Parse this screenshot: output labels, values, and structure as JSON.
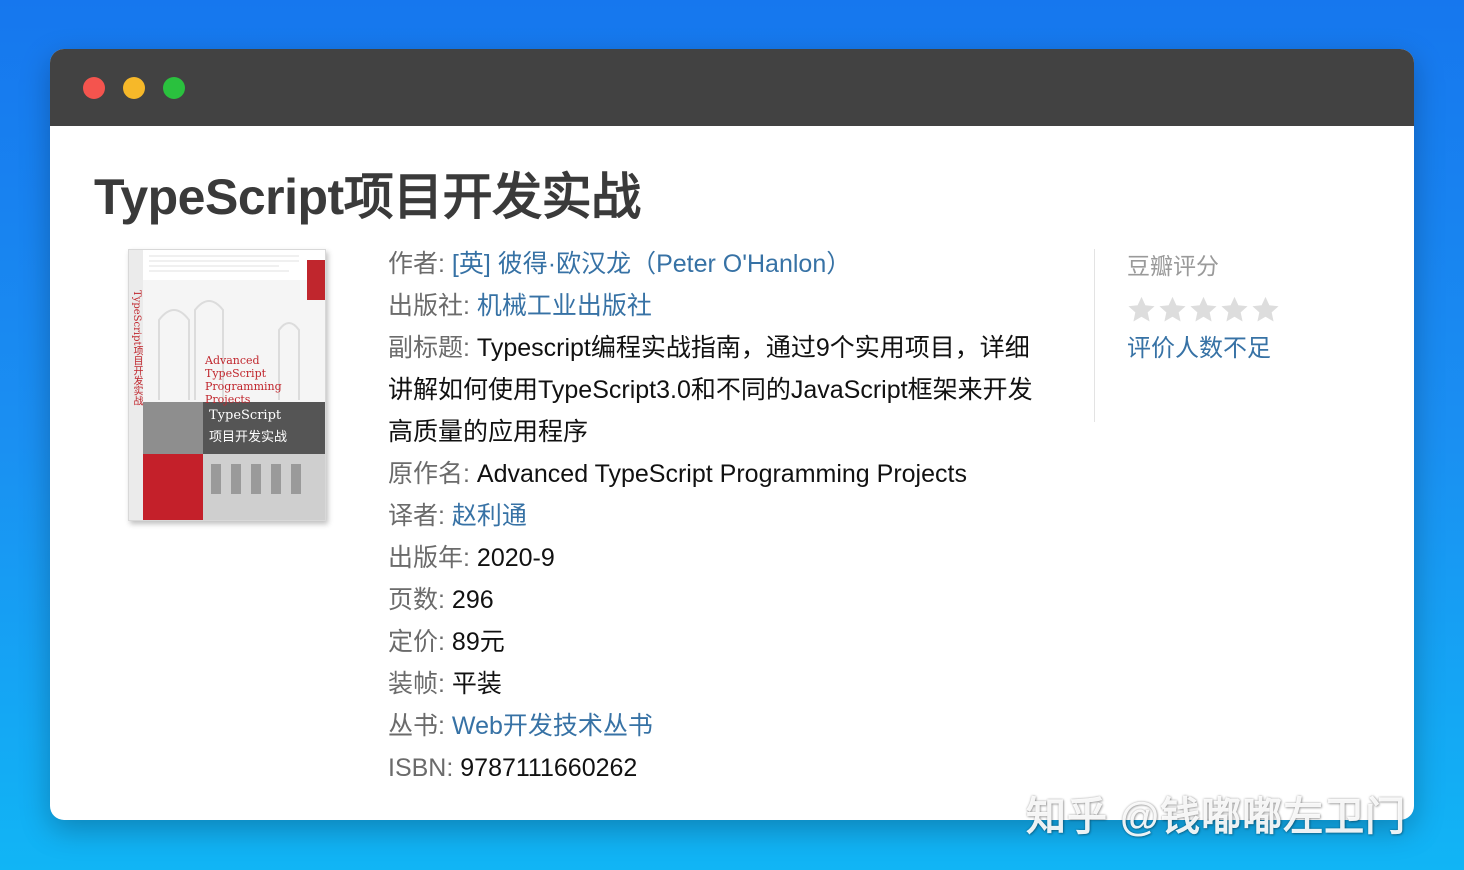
{
  "window": {
    "controls": {
      "close": "close",
      "minimize": "minimize",
      "zoom": "zoom"
    }
  },
  "book": {
    "title": "TypeScript项目开发实战",
    "cover": {
      "spine_text": "TypeScript项目开发实战",
      "subtitle_en": "Advanced TypeScript Programming Projects",
      "title_en": "TypeScript",
      "title_cn": "项目开发实战"
    },
    "details": [
      {
        "label": "作者",
        "value": "[英] 彼得·欧汉龙（Peter O'Hanlon）",
        "link": true
      },
      {
        "label": "出版社",
        "value": "机械工业出版社",
        "link": true
      },
      {
        "label": "副标题",
        "value": "Typescript编程实战指南，通过9个实用项目，详细讲解如何使用TypeScript3.0和不同的JavaScript框架来开发高质量的应用程序",
        "link": false
      },
      {
        "label": "原作名",
        "value": "Advanced TypeScript Programming Projects",
        "link": false
      },
      {
        "label": "译者",
        "value": "赵利通",
        "link": true
      },
      {
        "label": "出版年",
        "value": "2020-9",
        "link": false
      },
      {
        "label": "页数",
        "value": "296",
        "link": false
      },
      {
        "label": "定价",
        "value": "89元",
        "link": false
      },
      {
        "label": "装帧",
        "value": "平装",
        "link": false
      },
      {
        "label": "丛书",
        "value": "Web开发技术丛书",
        "link": true
      },
      {
        "label": "ISBN",
        "value": "9787111660262",
        "link": false
      }
    ]
  },
  "rating": {
    "title": "豆瓣评分",
    "stars_filled": 0,
    "stars_total": 5,
    "note": "评价人数不足"
  },
  "watermark": "知乎 @钱嘟嘟左卫门",
  "colors": {
    "background_top": "#1677ee",
    "background_bottom": "#11b5f5",
    "titlebar": "#424242",
    "link": "#3772a5",
    "label": "#6b6b6b",
    "star_empty": "#dddddd"
  }
}
